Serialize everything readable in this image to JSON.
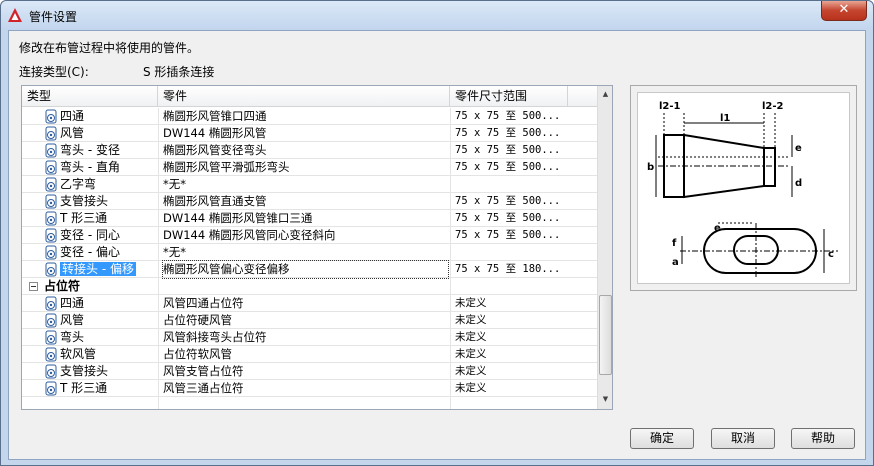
{
  "window": {
    "title": "管件设置",
    "close_label": "✕"
  },
  "description": "修改在布管过程中将使用的管件。",
  "connection": {
    "label": "连接类型(C):",
    "value": "S 形插条连接"
  },
  "grid": {
    "columns": [
      "类型",
      "零件",
      "零件尺寸范围"
    ],
    "rows": [
      {
        "type": "四通",
        "part": "椭圆形风管锥口四通",
        "size": "75 x 75 至 500..."
      },
      {
        "type": "风管",
        "part": "DW144 椭圆形风管",
        "size": "75 x 75 至 500..."
      },
      {
        "type": "弯头 - 变径",
        "part": "椭圆形风管变径弯头",
        "size": "75 x 75 至 500..."
      },
      {
        "type": "弯头 - 直角",
        "part": "椭圆形风管平滑弧形弯头",
        "size": "75 x 75 至 500..."
      },
      {
        "type": "乙字弯",
        "part": "*无*",
        "size": ""
      },
      {
        "type": "支管接头",
        "part": "椭圆形风管直通支管",
        "size": "75 x 75 至 500..."
      },
      {
        "type": "T 形三通",
        "part": "DW144 椭圆形风管锥口三通",
        "size": "75 x 75 至 500..."
      },
      {
        "type": "变径 - 同心",
        "part": "DW144 椭圆形风管同心变径斜向",
        "size": "75 x 75 至 500..."
      },
      {
        "type": "变径 - 偏心",
        "part": "*无*",
        "size": ""
      },
      {
        "type": "转接头 - 偏移",
        "part": "椭圆形风管偏心变径偏移",
        "size": "75 x 75 至 180..."
      }
    ],
    "group_label": "占位符",
    "placeholder_rows": [
      {
        "type": "四通",
        "part": "风管四通占位符",
        "size": "未定义"
      },
      {
        "type": "风管",
        "part": "占位符硬风管",
        "size": "未定义"
      },
      {
        "type": "弯头",
        "part": "风管斜接弯头占位符",
        "size": "未定义"
      },
      {
        "type": "软风管",
        "part": "占位符软风管",
        "size": "未定义"
      },
      {
        "type": "支管接头",
        "part": "风管支管占位符",
        "size": "未定义"
      },
      {
        "type": "T 形三通",
        "part": "风管三通占位符",
        "size": "未定义"
      }
    ],
    "scrollbar": {
      "up_icon": "▲",
      "down_icon": "▼"
    }
  },
  "preview": {
    "labels": {
      "l2_1": "l2-1",
      "l1": "l1",
      "l2_2": "l2-2",
      "b": "b",
      "d": "d",
      "e": "e",
      "f": "f",
      "a": "a",
      "c": "c"
    }
  },
  "buttons": {
    "ok": "确定",
    "cancel": "取消",
    "help": "帮助"
  }
}
